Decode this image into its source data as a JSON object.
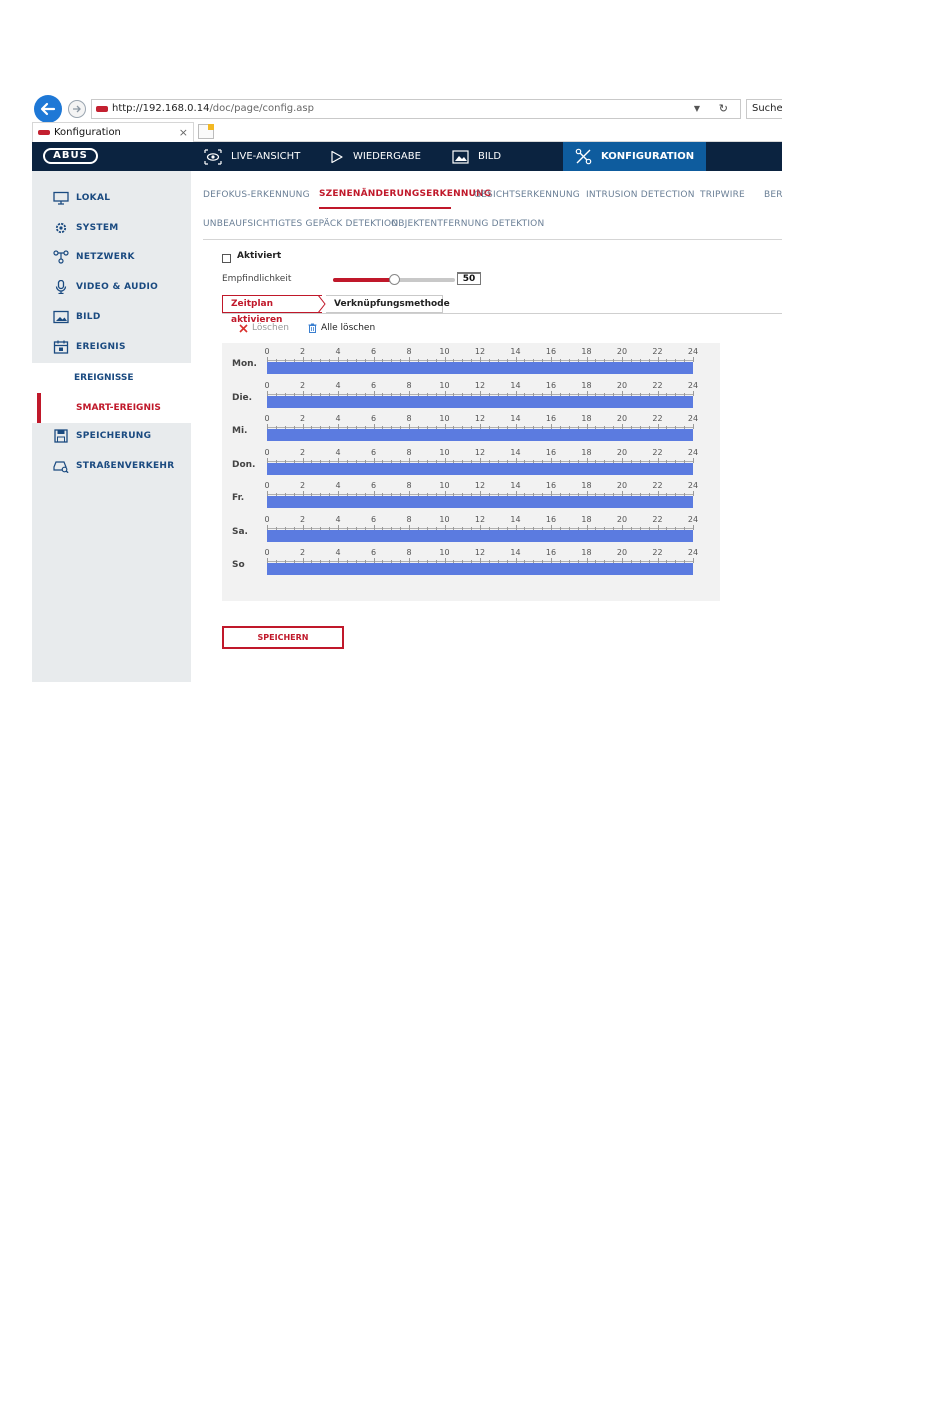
{
  "browser": {
    "address_host": "http://192.168.0.14",
    "address_path": "/doc/page/config.asp",
    "search_placeholder": "Suchen",
    "tab_title": "Konfiguration",
    "tab_close": "×"
  },
  "header": {
    "logo": "ABUS",
    "nav": [
      {
        "label": "LIVE-ANSICHT",
        "icon": "eye-icon"
      },
      {
        "label": "WIEDERGABE",
        "icon": "play-icon"
      },
      {
        "label": "BILD",
        "icon": "image-icon"
      },
      {
        "label": "KONFIGURATION",
        "icon": "tools-icon",
        "active": true
      }
    ]
  },
  "sidebar": {
    "items": [
      {
        "label": "LOKAL",
        "icon": "monitor-icon"
      },
      {
        "label": "SYSTEM",
        "icon": "gear-icon"
      },
      {
        "label": "NETZWERK",
        "icon": "network-icon"
      },
      {
        "label": "VIDEO & AUDIO",
        "icon": "microphone-icon"
      },
      {
        "label": "BILD",
        "icon": "image-icon"
      },
      {
        "label": "EREIGNIS",
        "icon": "calendar-icon"
      }
    ],
    "sub_items": [
      {
        "label": "EREIGNISSE",
        "active": false
      },
      {
        "label": "SMART-EREIGNIS",
        "active": true
      }
    ],
    "items_after": [
      {
        "label": "SPEICHERUNG",
        "icon": "save-disk-icon"
      },
      {
        "label": "STRAßENVERKEHR",
        "icon": "car-search-icon"
      }
    ]
  },
  "subtabs": {
    "row1": [
      "DEFOKUS-ERKENNUNG",
      "SZENENÄNDERUNGSERKENNUNG",
      "GESICHTSERKENNUNG",
      "INTRUSION DETECTION",
      "TRIPWIRE",
      "BER"
    ],
    "row2": [
      "UNBEAUFSICHTIGTES GEPÄCK DETEKTION",
      "OBJEKTENTFERNUNG DETEKTION"
    ],
    "active": "SZENENÄNDERUNGSERKENNUNG"
  },
  "form": {
    "enabled_label": "Aktiviert",
    "enabled": false,
    "sensitivity_label": "Empfindlichkeit",
    "sensitivity_value": "50",
    "sensitivity_max": 100
  },
  "wizard": {
    "tab_schedule": "Zeitplan aktivieren",
    "tab_linkage": "Verknüpfungsmethode"
  },
  "toolbar": {
    "delete_label": "Löschen",
    "delete_all_label": "Alle löschen"
  },
  "schedule": {
    "days": [
      "Mon.",
      "Die.",
      "Mi.",
      "Don.",
      "Fr.",
      "Sa.",
      "So"
    ],
    "hour_labels": [
      "0",
      "2",
      "4",
      "6",
      "8",
      "10",
      "12",
      "14",
      "16",
      "18",
      "20",
      "22",
      "24"
    ],
    "coverage": [
      [
        0,
        24
      ],
      [
        0,
        24
      ],
      [
        0,
        24
      ],
      [
        0,
        24
      ],
      [
        0,
        24
      ],
      [
        0,
        24
      ],
      [
        0,
        24
      ]
    ],
    "bar_color": "#5b7be0"
  },
  "actions": {
    "save_label": "SPEICHERN"
  },
  "colors": {
    "accent_red": "#c0182a",
    "header_navy": "#0b2340",
    "active_nav_blue": "#0e5c9e"
  }
}
